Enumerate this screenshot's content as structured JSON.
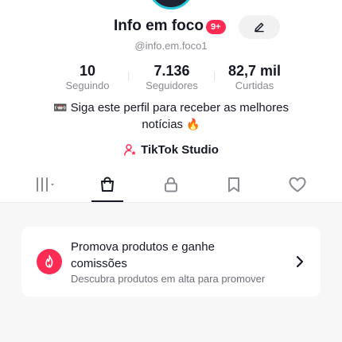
{
  "profile": {
    "username": "Info em foco",
    "notification_badge": "9+",
    "handle": "@info.em.foco1",
    "edit_icon": "pencil-icon"
  },
  "stats": [
    {
      "value": "10",
      "label": "Seguindo"
    },
    {
      "value": "7.136",
      "label": "Seguidores"
    },
    {
      "value": "82,7 mil",
      "label": "Curtidas"
    }
  ],
  "bio": {
    "line1_emoji": "📼",
    "line1": " Siga este perfil para receber as melhores",
    "line2": "notícias ",
    "line2_emoji": "🔥"
  },
  "studio": {
    "label": "TikTok Studio",
    "icon": "person-star-icon"
  },
  "tabs": [
    {
      "icon": "grid-icon",
      "active": false
    },
    {
      "icon": "shopping-bag-icon",
      "active": true
    },
    {
      "icon": "lock-icon",
      "active": false
    },
    {
      "icon": "bookmark-icon",
      "active": false
    },
    {
      "icon": "heart-icon",
      "active": false
    }
  ],
  "promo": {
    "title": "Promova produtos e ganhe comissões",
    "subtitle": "Descubra produtos em alta para promover",
    "icon": "flame-icon"
  },
  "colors": {
    "accent": "#fe2c55",
    "text": "#161823",
    "secondary_text": "#8a8b91",
    "background_gray": "#f7f7f8"
  }
}
